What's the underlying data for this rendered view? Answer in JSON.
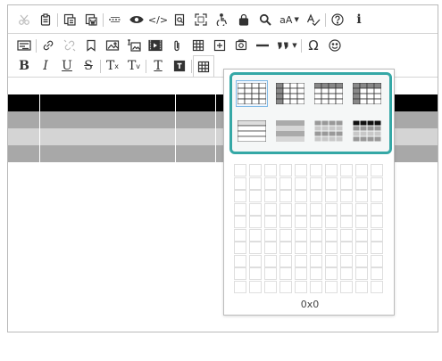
{
  "toolbar": {
    "row1": [
      {
        "name": "cut-icon",
        "disabled": true
      },
      {
        "name": "paste-icon"
      },
      {
        "sep": true
      },
      {
        "name": "paste-text-icon"
      },
      {
        "name": "paste-word-icon"
      },
      {
        "sep": true
      },
      {
        "name": "page-break-icon"
      },
      {
        "name": "preview-icon"
      },
      {
        "name": "source-code-icon",
        "text": "</>"
      },
      {
        "name": "find-icon"
      },
      {
        "name": "fullscreen-icon"
      },
      {
        "name": "accessibility-icon"
      },
      {
        "name": "lock-icon"
      },
      {
        "name": "search-icon"
      },
      {
        "name": "font-size-dropdown",
        "text": "aA",
        "caret": true
      },
      {
        "name": "spell-check-icon"
      },
      {
        "sep": true
      },
      {
        "name": "help-icon"
      },
      {
        "name": "info-icon",
        "text": "i"
      }
    ],
    "row2": [
      {
        "name": "format-painter-icon"
      },
      {
        "sep": true
      },
      {
        "name": "link-icon"
      },
      {
        "name": "unlink-icon",
        "disabled": true
      },
      {
        "name": "bookmark-icon"
      },
      {
        "name": "image-icon"
      },
      {
        "name": "image-map-icon"
      },
      {
        "name": "video-icon"
      },
      {
        "name": "attachment-icon"
      },
      {
        "name": "table-icon"
      },
      {
        "name": "special-box-icon"
      },
      {
        "name": "gallery-icon"
      },
      {
        "name": "horizontal-rule-icon"
      },
      {
        "name": "quote-dropdown",
        "caret": true
      },
      {
        "sep": true
      },
      {
        "name": "omega-icon",
        "text": "Ω"
      },
      {
        "name": "emoji-icon"
      }
    ],
    "row3": [
      {
        "name": "bold-button",
        "text": "B",
        "style": "bold"
      },
      {
        "name": "italic-button",
        "text": "I",
        "style": "italic"
      },
      {
        "name": "underline-button",
        "text": "U",
        "style": "underline"
      },
      {
        "name": "strikethrough-button",
        "text": "S",
        "style": "strike"
      },
      {
        "sep": true
      },
      {
        "name": "superscript-button",
        "text": "T",
        "sub": "x"
      },
      {
        "name": "subscript-button",
        "text": "T",
        "sub": "v"
      },
      {
        "sep": true
      },
      {
        "name": "clear-format-button",
        "text": "T"
      },
      {
        "name": "text-box-icon"
      },
      {
        "sep": true
      },
      {
        "name": "table-button-active",
        "active": true
      }
    ]
  },
  "table_popup": {
    "grid_rows": 10,
    "grid_cols": 10,
    "selection_label": "0x0",
    "presets": [
      {
        "name": "table-preset-plain",
        "selected": true
      },
      {
        "name": "table-preset-header-column"
      },
      {
        "name": "table-preset-header-row"
      },
      {
        "name": "table-preset-header-both"
      },
      {
        "name": "table-preset-striped-lines"
      },
      {
        "name": "table-preset-striped-fill"
      },
      {
        "name": "table-preset-gray-grid"
      },
      {
        "name": "table-preset-dark-header"
      }
    ]
  },
  "colors": {
    "accent": "#35a8a6",
    "header_row": "#000000",
    "row_dark": "#a8a8a8",
    "row_light": "#d4d4d4"
  }
}
